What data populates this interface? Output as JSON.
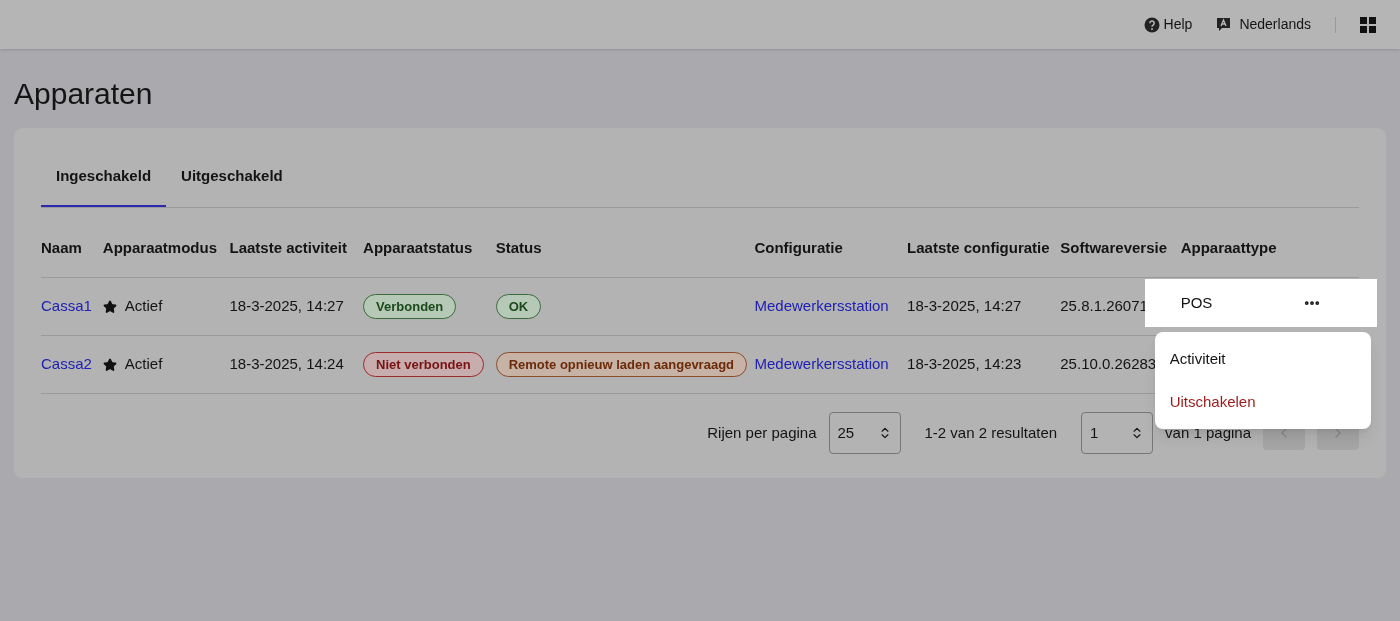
{
  "header": {
    "help": "Help",
    "language": "Nederlands"
  },
  "page_title": "Apparaten",
  "tabs": [
    {
      "label": "Ingeschakeld",
      "selected": true
    },
    {
      "label": "Uitgeschakeld",
      "selected": false
    }
  ],
  "table": {
    "columns": [
      "Naam",
      "Apparaatmodus",
      "Laatste activiteit",
      "Apparaatstatus",
      "Status",
      "Configuratie",
      "Laatste configuratie",
      "Softwareversie",
      "Apparaattype"
    ],
    "rows": [
      {
        "name": "Cassa1",
        "mode": "Actief",
        "last_activity": "18-3-2025, 14:27",
        "device_status": {
          "label": "Verbonden",
          "kind": "success"
        },
        "status": {
          "label": "OK",
          "kind": "success"
        },
        "configuration": "Medewerkersstation",
        "last_configuration": "18-3-2025, 14:27",
        "software_version": "25.8.1.26071",
        "device_type": "POS",
        "highlighted": true
      },
      {
        "name": "Cassa2",
        "mode": "Actief",
        "last_activity": "18-3-2025, 14:24",
        "device_status": {
          "label": "Niet verbonden",
          "kind": "error"
        },
        "status": {
          "label": "Remote opnieuw laden aangevraagd",
          "kind": "warning"
        },
        "configuration": "Medewerkersstation",
        "last_configuration": "18-3-2025, 14:23",
        "software_version": "25.10.0.26283",
        "highlighted": false
      }
    ]
  },
  "row_menu": {
    "items": [
      {
        "label": "Activiteit",
        "kind": "normal"
      },
      {
        "label": "Uitschakelen",
        "kind": "danger"
      }
    ]
  },
  "pagination": {
    "rows_per_page_label": "Rijen per pagina",
    "rows_per_page": "25",
    "results": "1-2 van 2 resultaten",
    "page": "1",
    "page_total": "van 1 pagina"
  }
}
